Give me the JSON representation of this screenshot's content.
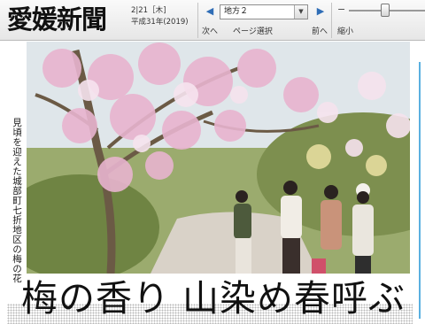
{
  "header": {
    "logo": "愛媛新聞",
    "date": "2|21［木]",
    "era_year": "平成31年(2019)",
    "region_select": "地方２",
    "prev_label": "次へ",
    "page_select_label": "ページ選択",
    "next_label": "前へ",
    "zoom_minus": "−",
    "zoom_out_label": "縮小",
    "zoom_level": 0.45
  },
  "article": {
    "photo_caption": "見頃を迎えた城部町七折地区の梅の花",
    "headline": "梅の香り 山染め春呼ぶ"
  },
  "colors": {
    "accent_blue": "#2f6db6",
    "side_rule": "#5ab0e0"
  }
}
